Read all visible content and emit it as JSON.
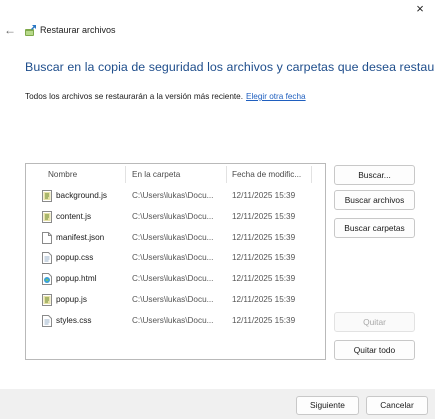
{
  "window": {
    "title": "Restaurar archivos",
    "close_glyph": "×",
    "back_glyph": "←"
  },
  "heading": "Buscar en la copia de seguridad los archivos y carpetas que desea restaurar",
  "info": {
    "text": "Todos los archivos se restaurarán a la versión más reciente.",
    "link": "Elegir otra fecha"
  },
  "columns": {
    "name": "Nombre",
    "folder": "En la carpeta",
    "date": "Fecha de modific..."
  },
  "files": [
    {
      "name": "background.js",
      "folder": "C:\\Users\\lukas\\Docu...",
      "date": "12/11/2025 15:39",
      "icon": "js-file-icon"
    },
    {
      "name": "content.js",
      "folder": "C:\\Users\\lukas\\Docu...",
      "date": "12/11/2025 15:39",
      "icon": "js-file-icon"
    },
    {
      "name": "manifest.json",
      "folder": "C:\\Users\\lukas\\Docu...",
      "date": "12/11/2025 15:39",
      "icon": "json-file-icon"
    },
    {
      "name": "popup.css",
      "folder": "C:\\Users\\lukas\\Docu...",
      "date": "12/11/2025 15:39",
      "icon": "css-file-icon"
    },
    {
      "name": "popup.html",
      "folder": "C:\\Users\\lukas\\Docu...",
      "date": "12/11/2025 15:39",
      "icon": "html-file-icon"
    },
    {
      "name": "popup.js",
      "folder": "C:\\Users\\lukas\\Docu...",
      "date": "12/11/2025 15:39",
      "icon": "js-file-icon"
    },
    {
      "name": "styles.css",
      "folder": "C:\\Users\\lukas\\Docu...",
      "date": "12/11/2025 15:39",
      "icon": "css-file-icon"
    }
  ],
  "buttons": {
    "search": "Buscar...",
    "search_files": "Buscar archivos",
    "search_folders": "Buscar carpetas",
    "remove": "Quitar",
    "remove_all": "Quitar todo"
  },
  "footer": {
    "next": "Siguiente",
    "cancel": "Cancelar"
  },
  "colors": {
    "heading": "#1f4e8c",
    "link": "#1f5fbf",
    "footer_bg": "#f0f0f0"
  }
}
